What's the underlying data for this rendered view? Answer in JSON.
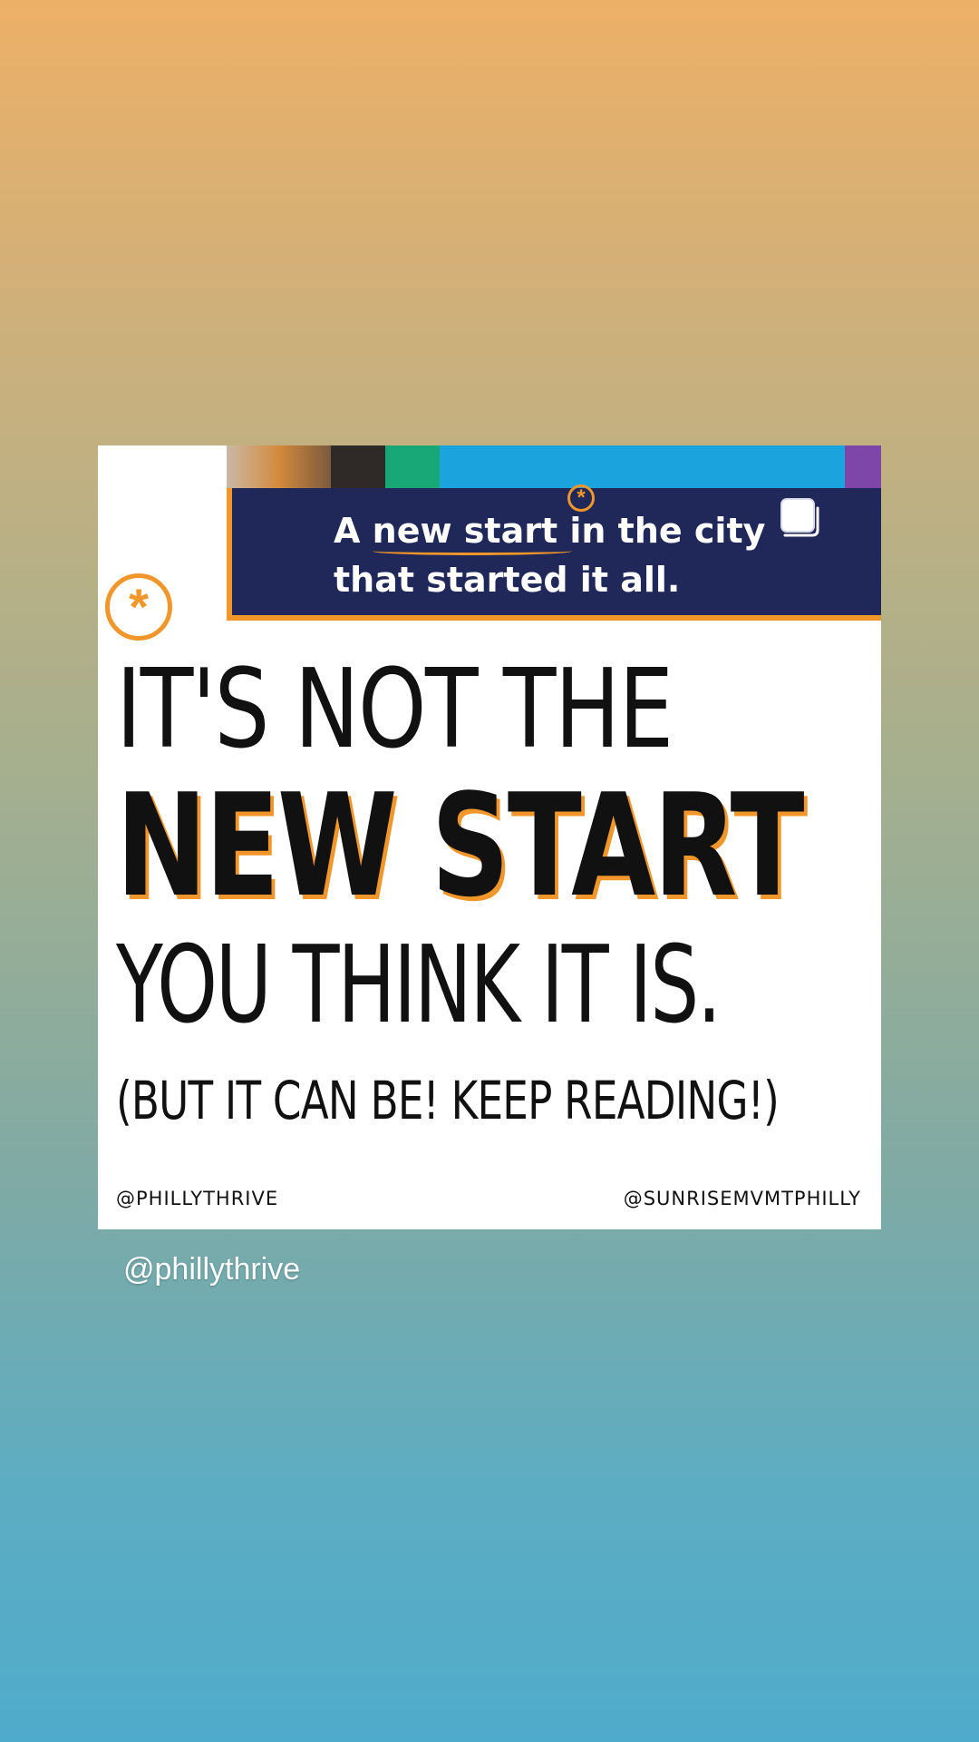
{
  "post": {
    "banner_line1_a": "A ",
    "banner_line1_b": "new start",
    "banner_line1_c": " in the city",
    "banner_line2": "that started it all.",
    "headline_line1": "IT'S NOT THE",
    "headline_line2": "NEW START",
    "headline_line3": "YOU THINK IT IS.",
    "headline_line4": "(BUT IT CAN BE! KEEP READING!)",
    "credit_left": "@PHILLYTHRIVE",
    "credit_right": "@SUNRISEMVMTPHILLY",
    "accent_color": "#F0962B",
    "banner_color": "#1f2858"
  },
  "story": {
    "username": "@phillythrive"
  },
  "icons": [
    "asterisk-circle-icon",
    "small-asterisk-icon",
    "square-sticker-icon"
  ]
}
